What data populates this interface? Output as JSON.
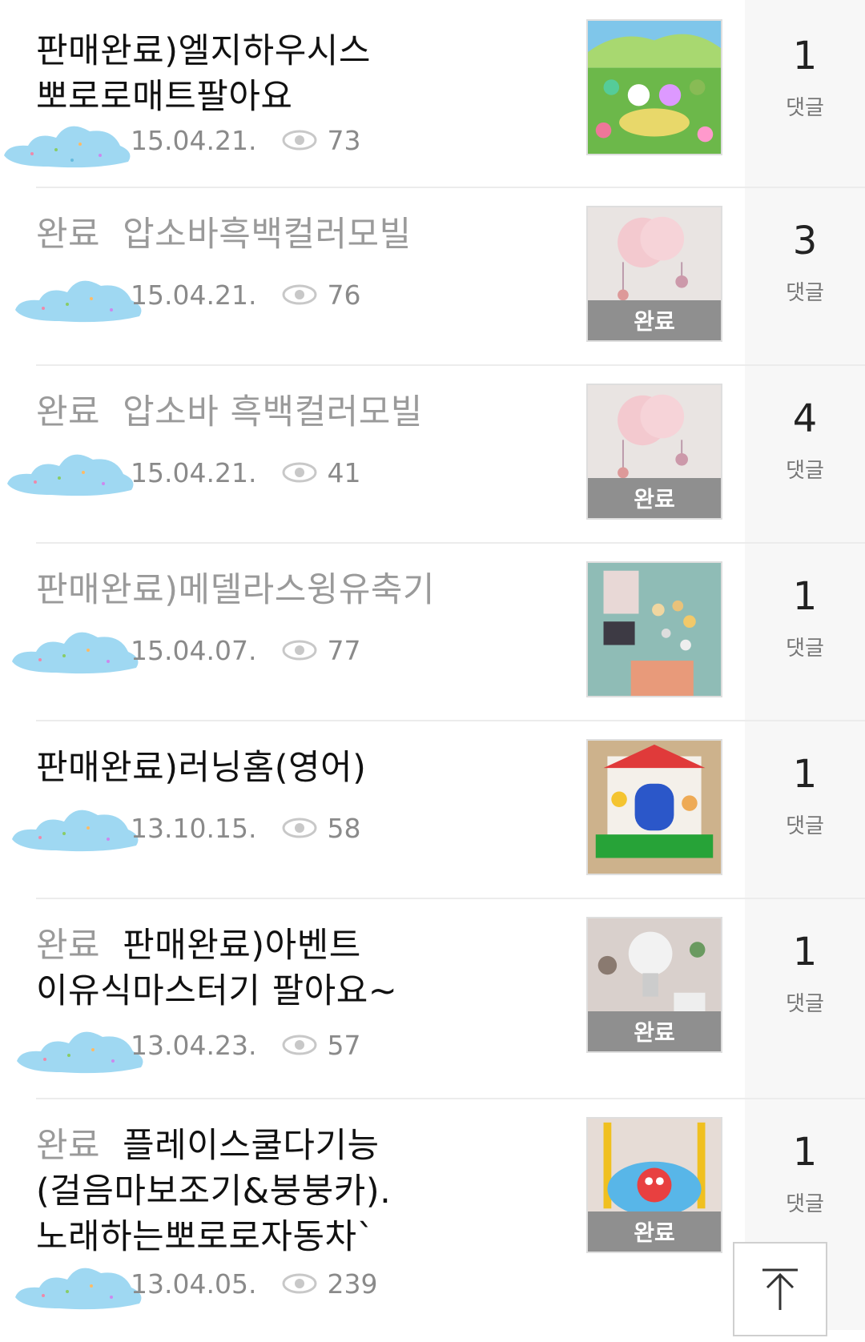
{
  "posts": [
    {
      "tag": "",
      "title": "판매완료)엘지하우시스 뽀로로매트팔아요",
      "date": "15.04.21.",
      "views": "73",
      "comments": "1",
      "comment_label": "댓글",
      "badge": ""
    },
    {
      "tag": "완료",
      "title": "압소바흑백컬러모빌",
      "date": "15.04.21.",
      "views": "76",
      "comments": "3",
      "comment_label": "댓글",
      "badge": "완료"
    },
    {
      "tag": "완료",
      "title": "압소바 흑백컬러모빌",
      "date": "15.04.21.",
      "views": "41",
      "comments": "4",
      "comment_label": "댓글",
      "badge": "완료"
    },
    {
      "tag": "",
      "title": "판매완료)메델라스윙유축기",
      "date": "15.04.07.",
      "views": "77",
      "comments": "1",
      "comment_label": "댓글",
      "badge": ""
    },
    {
      "tag": "",
      "title": "판매완료)러닝홈(영어)",
      "date": "13.10.15.",
      "views": "58",
      "comments": "1",
      "comment_label": "댓글",
      "badge": ""
    },
    {
      "tag": "완료",
      "title": "판매완료)아벤트 이유식마스터기 팔아요~",
      "date": "13.04.23.",
      "views": "57",
      "comments": "1",
      "comment_label": "댓글",
      "badge": "완료"
    },
    {
      "tag": "완료",
      "title": "플레이스쿨다기능(걸음마보조기&붕붕카).노래하는뽀로로자동차`",
      "date": "13.04.05.",
      "views": "239",
      "comments": "1",
      "comment_label": "댓글",
      "badge": "완료"
    }
  ],
  "icons": {
    "views": "eye-icon",
    "scroll_top": "arrow-up-to-top-icon"
  },
  "colors": {
    "text": "#111111",
    "muted": "#9a9a9a",
    "badge_bg": "#8f8f8f",
    "cloud": "#9fd8f2"
  }
}
